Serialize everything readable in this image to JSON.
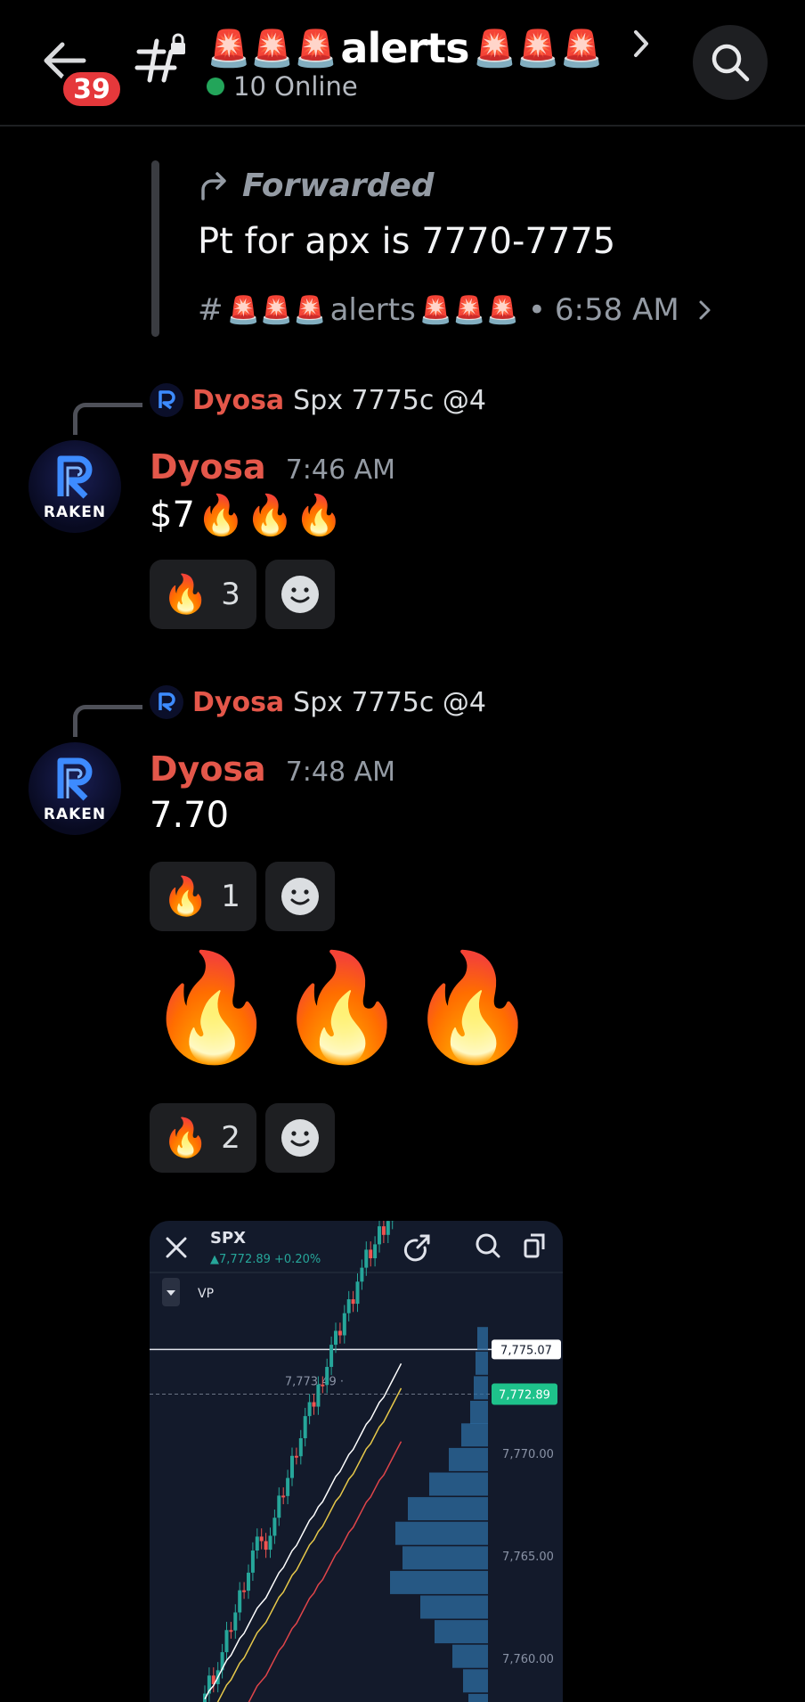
{
  "header": {
    "unread_count": "39",
    "channel_name": "alerts",
    "channel_emoji": "🚨🚨🚨",
    "online_text": "10 Online"
  },
  "forwarded": {
    "label": "Forwarded",
    "text": "Pt for apx is 7770-7775",
    "source_prefix": "#",
    "source_emoji_left": "🚨🚨🚨",
    "source_channel": "alerts",
    "source_emoji_right": "🚨🚨🚨",
    "sep": "•",
    "time": "6:58 AM"
  },
  "messages": [
    {
      "reply_author": "Dyosa",
      "reply_text": "Spx 7775c @4",
      "author": "Dyosa",
      "avatar_text": "RAKEN",
      "time": "7:46 AM",
      "text": "$7",
      "text_emoji": "🔥🔥🔥",
      "reactions": [
        {
          "emoji": "🔥",
          "count": "3"
        }
      ]
    },
    {
      "reply_author": "Dyosa",
      "reply_text": "Spx 7775c @4",
      "author": "Dyosa",
      "avatar_text": "RAKEN",
      "time": "7:48 AM",
      "text": "7.70",
      "reactions": [
        {
          "emoji": "🔥",
          "count": "1"
        }
      ]
    },
    {
      "big_emoji": "🔥🔥🔥",
      "reactions": [
        {
          "emoji": "🔥",
          "count": "2"
        }
      ]
    }
  ],
  "chart_card": {
    "symbol": "SPX",
    "change": "▲7,772.89 +0.20%",
    "indicator": "VP",
    "accent": "#26a69a",
    "down_color": "#ef5350"
  },
  "chart_data": {
    "type": "candlestick",
    "price_labels": [
      "7,775.07",
      "7,772.89",
      "7,770.00",
      "7,765.00",
      "7,760.00"
    ],
    "annotation": "7,773.49",
    "ylim": [
      7757,
      7777
    ],
    "current_price": 7772.89,
    "high_line": 7775.07,
    "y_ticks": [
      7770,
      7765,
      7760
    ]
  },
  "colors": {
    "author": "#e4574a",
    "online": "#23a55a",
    "badge": "#e5383b"
  }
}
